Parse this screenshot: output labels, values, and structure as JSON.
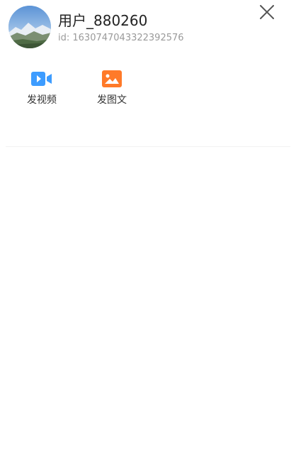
{
  "user": {
    "name": "用户_880260",
    "id_text": "id: 1630747043322392576"
  },
  "actions": [
    {
      "label": "发视频",
      "icon": "video-icon",
      "color": "#3d9cff"
    },
    {
      "label": "发图文",
      "icon": "image-icon",
      "color": "#ff7a29"
    }
  ],
  "close": {
    "icon": "close-icon"
  }
}
